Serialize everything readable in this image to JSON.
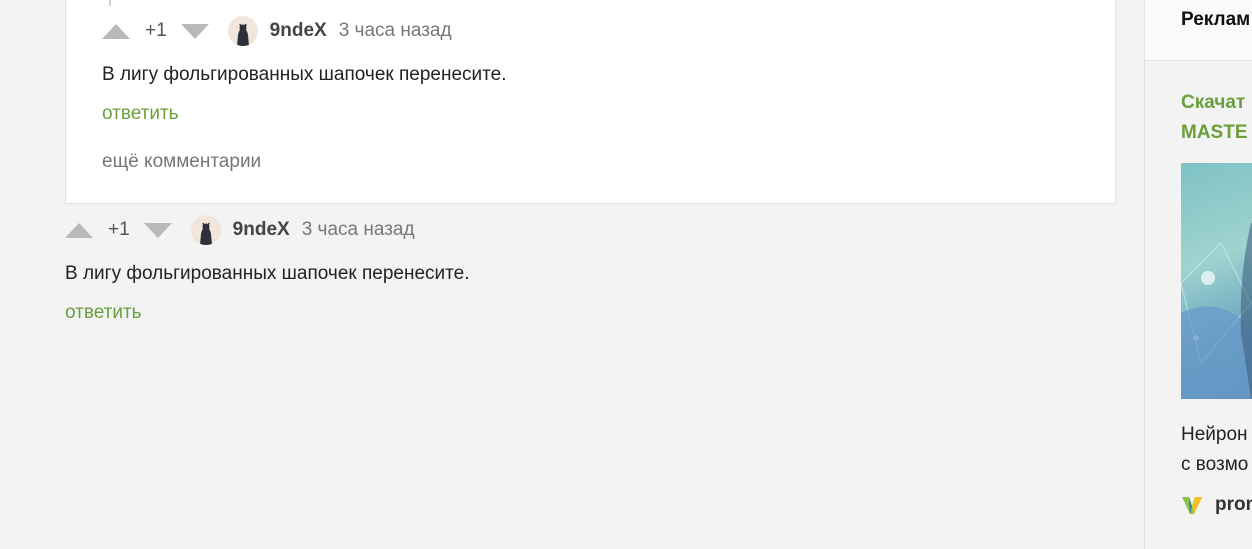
{
  "comments": [
    {
      "rating": "+1",
      "author": "9ndeX",
      "time": "3 часа назад",
      "text": "В лигу фольгированных шапочек перенесите.",
      "reply_label": "ответить",
      "more_label": "ещё комментарии"
    },
    {
      "rating": "+1",
      "author": "9ndeX",
      "time": "3 часа назад",
      "text": "В лигу фольгированных шапочек перенесите.",
      "reply_label": "ответить"
    }
  ],
  "sidebar": {
    "header": "Реклам",
    "ad": {
      "title_line1": "Скачат",
      "title_line2": "MASTE",
      "desc_line1": "Нейрон",
      "desc_line2": "с возмо",
      "brand": "prom"
    }
  },
  "colors": {
    "accent_green": "#6a9f3b",
    "background": "#f3f3f3",
    "card": "#ffffff"
  },
  "icons": {
    "vote_up": "triangle-up-icon",
    "vote_down": "triangle-down-icon",
    "brand_logo": "v-logo-icon"
  }
}
